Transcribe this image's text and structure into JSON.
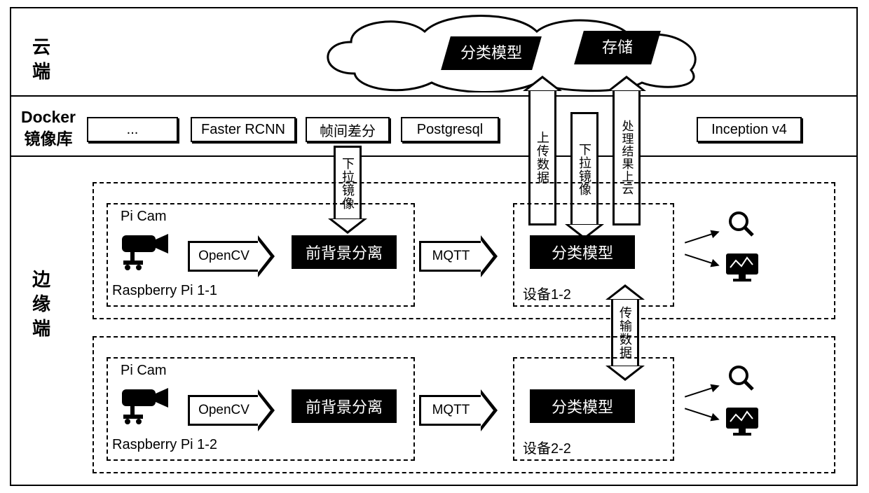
{
  "rows": {
    "cloud_label": "云\n端",
    "docker_label_l1": "Docker",
    "docker_label_l2": "镜像库",
    "edge_label": "边\n缘\n端"
  },
  "cloud": {
    "classifier": "分类模型",
    "storage": "存储"
  },
  "docker_images": {
    "ellipsis": "...",
    "faster_rcnn": "Faster RCNN",
    "frame_diff": "帧间差分",
    "postgresql": "Postgresql",
    "inception": "Inception v4"
  },
  "vertical_arrows": {
    "pull_image_top": "下拉镜像",
    "upload_data": "上传数据",
    "pull_image_mid": "下拉镜像",
    "result_to_cloud": "处理结果上云",
    "transfer_data": "传输数据"
  },
  "pipeline": {
    "picam": "Pi Cam",
    "rpi1": "Raspberry Pi 1-1",
    "rpi2": "Raspberry Pi 1-2",
    "opencv": "OpenCV",
    "fg_bg": "前背景分离",
    "mqtt": "MQTT",
    "classifier": "分类模型",
    "device1": "设备1-2",
    "device2": "设备2-2"
  }
}
